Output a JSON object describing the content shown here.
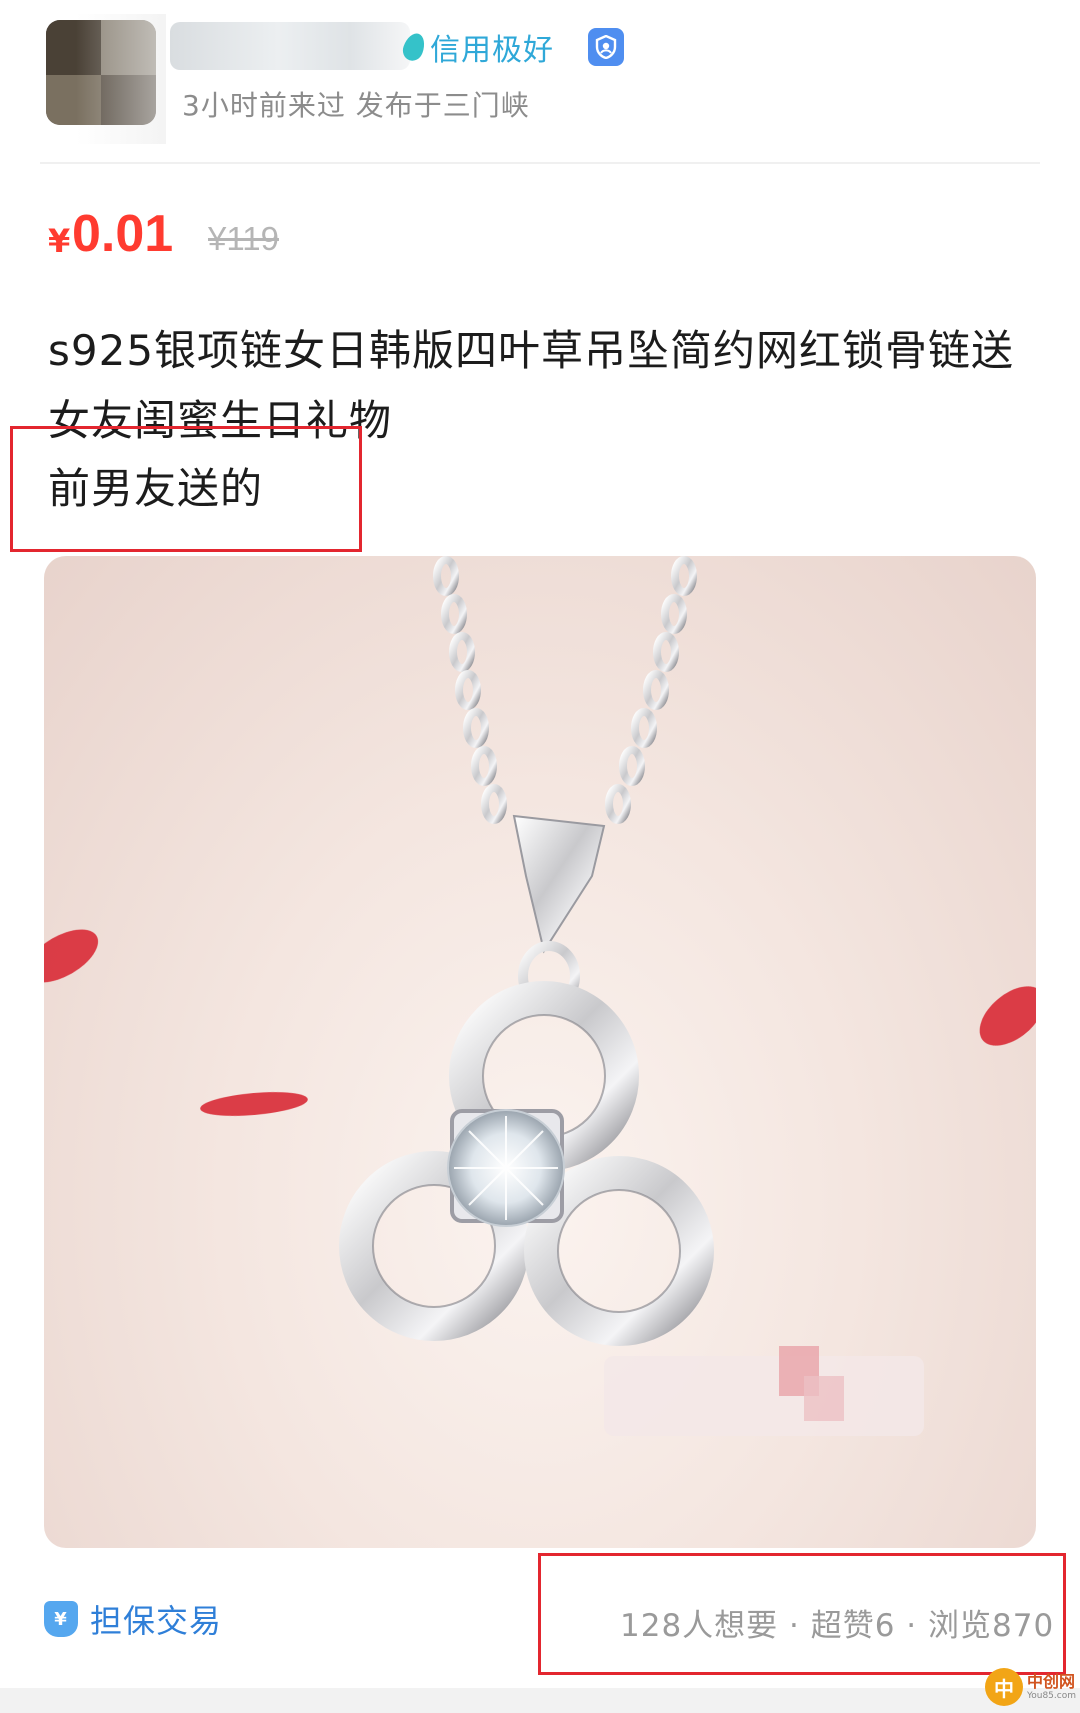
{
  "seller": {
    "credit_label": "信用极好",
    "sub_info": "3小时前来过  发布于三门峡"
  },
  "price": {
    "currency": "¥",
    "current": "0.01",
    "original": "¥119"
  },
  "item": {
    "title": "s925银项链女日韩版四叶草吊坠简约网红锁骨链送女友闺蜜生日礼物",
    "note": "前男友送的"
  },
  "footer": {
    "guarantee_label": "担保交易",
    "stats": "128人想要 · 超赞6 · 浏览870"
  },
  "watermark": {
    "logo_char": "中",
    "brand": "中创网",
    "domain": "You85.com"
  },
  "colors": {
    "price": "#ff3b30",
    "accent_blue": "#2f7fd8",
    "highlight_box": "#e3262f"
  }
}
